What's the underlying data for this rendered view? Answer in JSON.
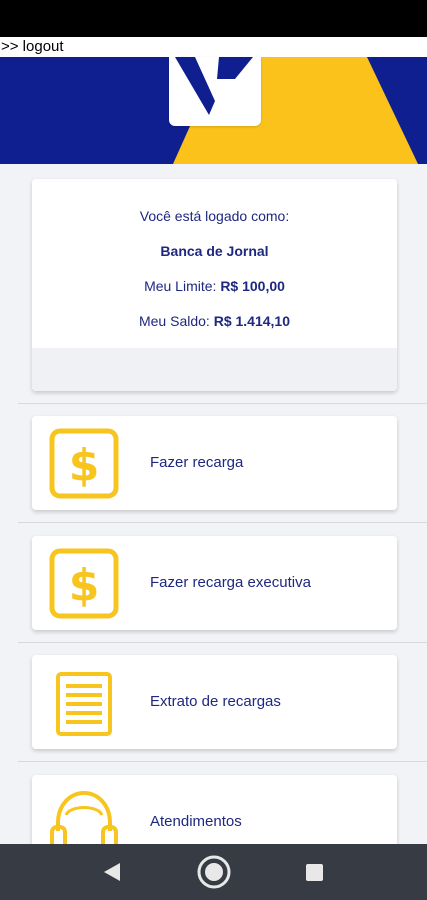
{
  "top_link": {
    "label": ">> logout"
  },
  "account": {
    "logged_as_label": "Você está logado como:",
    "user_name": "Banca de Jornal",
    "limit_label": "Meu Limite:",
    "limit_value": "R$ 100,00",
    "balance_label": "Meu Saldo:",
    "balance_value": "R$ 1.414,10"
  },
  "menu": [
    {
      "label": "Fazer recarga",
      "icon": "dollar-icon"
    },
    {
      "label": "Fazer recarga executiva",
      "icon": "dollar-icon"
    },
    {
      "label": "Extrato de recargas",
      "icon": "document-icon"
    },
    {
      "label": "Atendimentos",
      "icon": "headset-icon"
    }
  ],
  "colors": {
    "navy": "#0f1f8f",
    "yellow": "#fbc21c",
    "text": "#1e2880",
    "icon": "#f7c51e",
    "nav_bar": "#363b44"
  }
}
